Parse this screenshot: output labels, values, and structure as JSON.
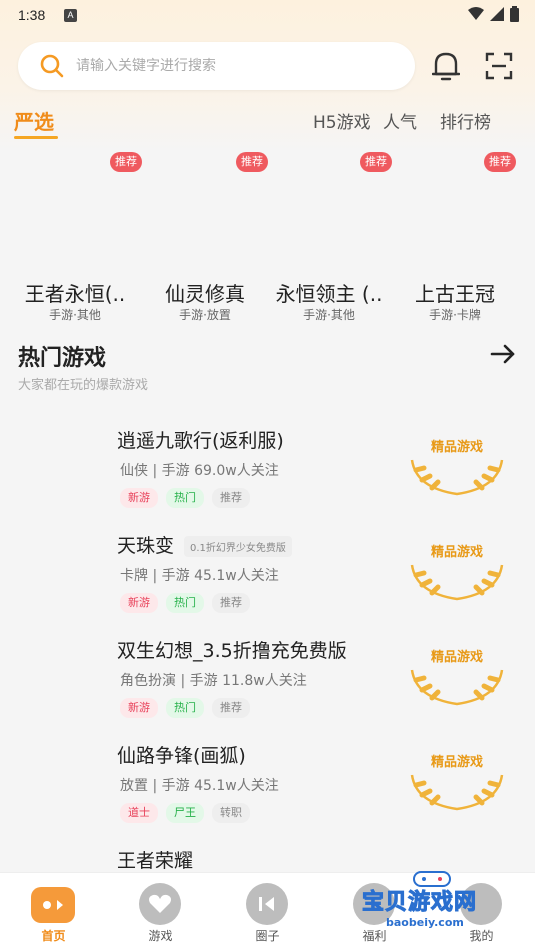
{
  "status": {
    "time": "1:38",
    "notif_letter": "A"
  },
  "search": {
    "placeholder": "请输入关键字进行搜索"
  },
  "tabs": [
    {
      "label": "严选",
      "active": true
    },
    {
      "label": "H5游戏"
    },
    {
      "label": "人气"
    },
    {
      "label": "排行榜"
    }
  ],
  "recommended": [
    {
      "badge": "推荐",
      "title": "王者永恒(..",
      "sub": "手游·其他"
    },
    {
      "badge": "推荐",
      "title": "仙灵修真",
      "sub": "手游·放置"
    },
    {
      "badge": "推荐",
      "title": "永恒领主  (..",
      "sub": "手游·其他"
    },
    {
      "badge": "推荐",
      "title": "上古王冠",
      "sub": "手游·卡牌"
    }
  ],
  "hot": {
    "title": "热门游戏",
    "subtitle": "大家都在玩的爆款游戏",
    "games": [
      {
        "name": "逍遥九歌行(返利服)",
        "promo": "",
        "meta": "仙侠 | 手游  69.0w人关注",
        "tags": [
          "新游",
          "热门",
          "推荐"
        ],
        "badge": "精品游戏"
      },
      {
        "name": "天珠变",
        "promo": "0.1折幻界少女免费版",
        "meta": "卡牌 | 手游  45.1w人关注",
        "tags": [
          "新游",
          "热门",
          "推荐"
        ],
        "badge": "精品游戏"
      },
      {
        "name": "双生幻想_3.5折撸充免费版",
        "promo": "",
        "meta": "角色扮演 | 手游  11.8w人关注",
        "tags": [
          "新游",
          "热门",
          "推荐"
        ],
        "badge": "精品游戏"
      },
      {
        "name": "仙路争锋(画狐)",
        "promo": "",
        "meta": "放置 | 手游  45.1w人关注",
        "tags": [
          "道士",
          "尸王",
          "转职"
        ],
        "badge": "精品游戏"
      },
      {
        "name": "王者荣耀",
        "promo": "",
        "meta": "",
        "tags": [],
        "badge": ""
      }
    ]
  },
  "nav": [
    {
      "label": "首页",
      "active": true
    },
    {
      "label": "游戏"
    },
    {
      "label": "圈子"
    },
    {
      "label": "福利"
    },
    {
      "label": "我的"
    }
  ],
  "watermark": {
    "title": "宝贝游戏网",
    "url": "baobeiy.com"
  },
  "colors": {
    "accent": "#f08c1a",
    "badge_red": "#ef5a5f",
    "gold": "#e89a18"
  }
}
